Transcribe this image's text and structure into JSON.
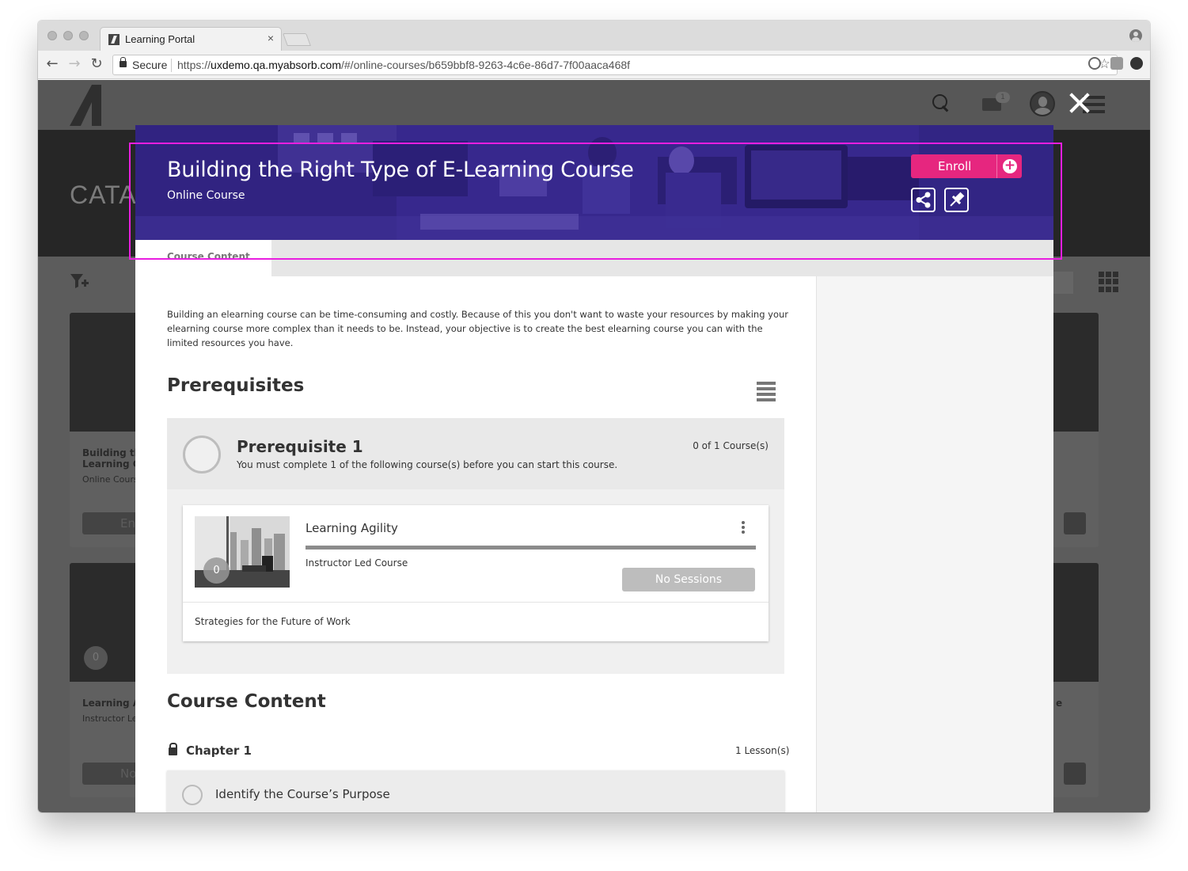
{
  "browser": {
    "tab_title": "Learning Portal",
    "tab_close": "×",
    "secure_label": "Secure",
    "url_scheme": "https://",
    "url_host": "uxdemo.qa.myabsorb.com",
    "url_path": "/#/online-courses/b659bbf8-9263-4c6e-86d7-7f00aaca468f",
    "back": "←",
    "forward": "→",
    "reload": "↻",
    "bookmark": "☆"
  },
  "header": {
    "mail_badge": "1"
  },
  "background": {
    "catalog_title": "CATA",
    "cards": [
      {
        "title": "Building th\nLearning Co",
        "subtitle": "Online Cours",
        "button": "En"
      },
      {
        "title": "Learning Ag",
        "subtitle": "Instructor Le",
        "button": "No",
        "badge": "0"
      }
    ],
    "right_card_snippet": "e"
  },
  "modal": {
    "title": "Building the Right Type of E-Learning Course",
    "subtitle": "Online Course",
    "enroll_label": "Enroll",
    "tab_label": "Course Content",
    "description": "Building an elearning course can be time-consuming and costly.  Because of this you don't want to waste your resources by making your elearning course more complex than it needs to be.  Instead, your objective is to create the best elearning course you can with the limited resources you have.",
    "prerequisites_heading": "Prerequisites",
    "prerequisite": {
      "title": "Prerequisite 1",
      "description": "You must complete 1 of the following course(s) before you can start this course.",
      "count": "0 of 1 Course(s)",
      "course": {
        "name": "Learning Agility",
        "type": "Instructor Led Course",
        "badge": "0",
        "progress": 1.0,
        "sessions_button": "No Sessions",
        "footer": "Strategies for the Future of Work"
      }
    },
    "content_heading": "Course Content",
    "chapter": {
      "title": "Chapter 1",
      "count": "1 Lesson(s)",
      "lessons": [
        "Identify the Course’s Purpose"
      ]
    }
  },
  "colors": {
    "accent": "#e6267f",
    "banner": "#3a2b86",
    "highlight": "#e91ee0"
  }
}
